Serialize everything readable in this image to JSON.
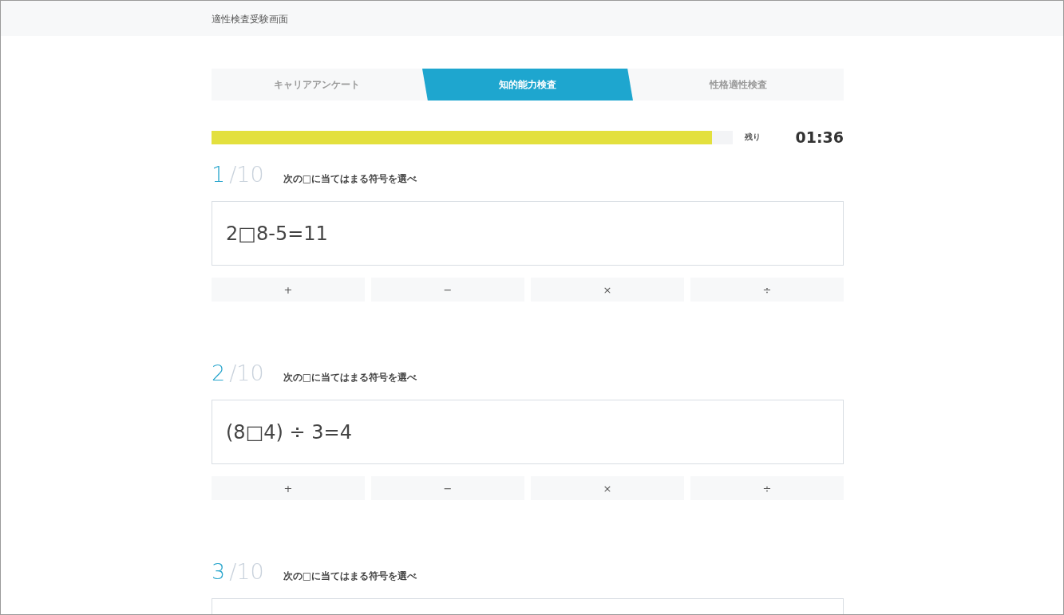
{
  "header": {
    "title": "適性検査受験画面"
  },
  "tabs": [
    {
      "label": "キャリアアンケート",
      "selected": false
    },
    {
      "label": "知的能力検査",
      "selected": true
    },
    {
      "label": "性格適性検査",
      "selected": false
    }
  ],
  "progress": {
    "level": 0.96,
    "remaining_label": "残り",
    "time": "01:36"
  },
  "questions": [
    {
      "number": "1",
      "total": "/10",
      "instruction": "次の□に当てはまる符号を選べ",
      "equation": "2□8-5=11",
      "options": [
        "+",
        "−",
        "×",
        "÷"
      ]
    },
    {
      "number": "2",
      "total": "/10",
      "instruction": "次の□に当てはまる符号を選べ",
      "equation": "(8□4) ÷ 3=4",
      "options": [
        "+",
        "−",
        "×",
        "÷"
      ]
    },
    {
      "number": "3",
      "total": "/10",
      "instruction": "次の□に当てはまる符号を選べ"
    }
  ]
}
